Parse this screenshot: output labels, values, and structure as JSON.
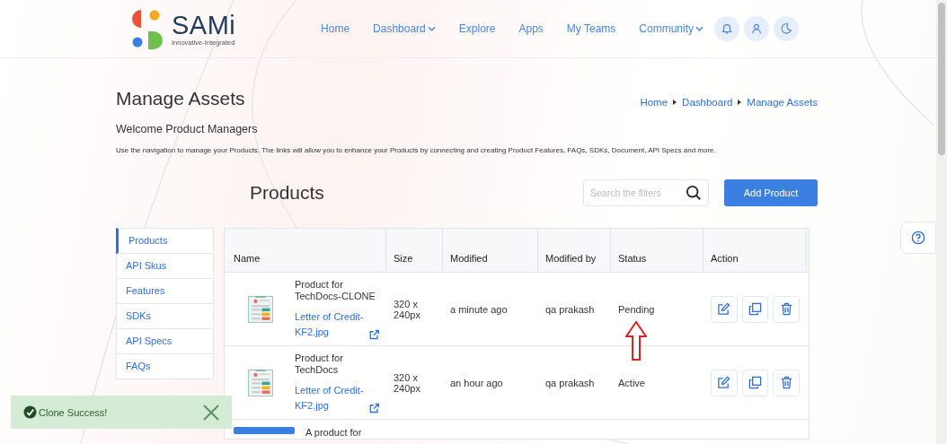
{
  "brand": {
    "name": "SAMi",
    "tagline": "Innovative-Integrated"
  },
  "nav": [
    {
      "label": "Home",
      "has_menu": false
    },
    {
      "label": "Dashboard",
      "has_menu": true
    },
    {
      "label": "Explore",
      "has_menu": false
    },
    {
      "label": "Apps",
      "has_menu": false
    },
    {
      "label": "My Teams",
      "has_menu": false
    },
    {
      "label": "Community",
      "has_menu": true
    }
  ],
  "page": {
    "title": "Manage Assets",
    "breadcrumb": [
      "Home",
      "Dashboard",
      "Manage Assets"
    ],
    "welcome": "Welcome Product Managers",
    "intro": "Use the navigation to manage your Products. The links will allow you to enhance your Products by connecting and creating Product Features, FAQs, SDKs, Document, API Specs and more."
  },
  "sidebar": [
    {
      "label": "Products",
      "selected": true
    },
    {
      "label": "API Skus",
      "selected": false
    },
    {
      "label": "Features",
      "selected": false
    },
    {
      "label": "SDKs",
      "selected": false
    },
    {
      "label": "API Specs",
      "selected": false
    },
    {
      "label": "FAQs",
      "selected": false
    }
  ],
  "products": {
    "title": "Products",
    "search": {
      "placeholder": "Search the filters"
    },
    "add_button": "Add Product",
    "columns": [
      "Name",
      "Size",
      "Modified",
      "Modified by",
      "Status",
      "Action"
    ],
    "rows": [
      {
        "name": "Product for TechDocs-CLONE",
        "file": "Letter of Credit-KF2.jpg",
        "size": "320 x 240px",
        "modified": "a minute ago",
        "modified_by": "qa prakash",
        "status": "Pending",
        "pointed_at": true
      },
      {
        "name": "Product for TechDocs",
        "file": "Letter of Credit-KF2.jpg",
        "size": "320 x 240px",
        "modified": "an hour ago",
        "modified_by": "qa prakash",
        "status": "Active",
        "pointed_at": false
      }
    ],
    "partial_row": {
      "name": "A product for"
    }
  },
  "toast": {
    "message": "Clone Success!"
  }
}
